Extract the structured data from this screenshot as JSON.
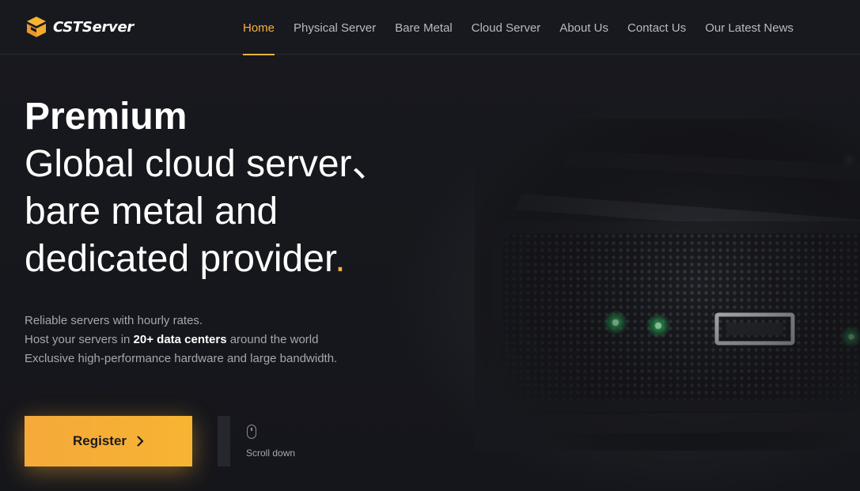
{
  "brand": {
    "name": "CSTServer",
    "accent": "#f6b13a"
  },
  "nav": {
    "items": [
      {
        "label": "Home",
        "active": true
      },
      {
        "label": "Physical Server"
      },
      {
        "label": "Bare Metal"
      },
      {
        "label": "Cloud Server"
      },
      {
        "label": "About Us"
      },
      {
        "label": "Contact Us"
      },
      {
        "label": "Our Latest News"
      }
    ]
  },
  "hero": {
    "headline_strong": "Premium",
    "headline_lines": [
      "Global cloud server、",
      "bare metal and",
      "dedicated provider"
    ],
    "headline_dot": ".",
    "desc": {
      "line1": "Reliable servers with hourly rates.",
      "line2_pre": "Host your servers in ",
      "line2_bold": "20+ data centers",
      "line2_post": " around the world",
      "line3": "Exclusive high-performance hardware and large bandwidth."
    },
    "register_label": "Register",
    "scroll_label": "Scroll down"
  },
  "icons": {
    "logo": "cube-logo-icon",
    "register_arrow": "chevron-right-icon",
    "scroll": "mouse-icon"
  }
}
